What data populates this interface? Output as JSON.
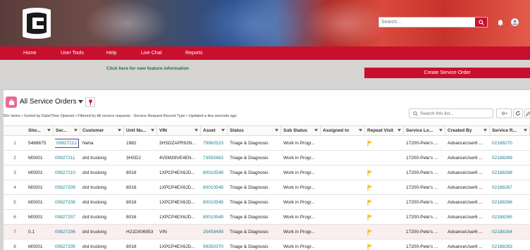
{
  "header": {
    "brand": "Cummins",
    "search_placeholder": "Search..."
  },
  "nav": {
    "items": [
      {
        "label": "Home"
      },
      {
        "label": "User Tools"
      },
      {
        "label": "Help"
      },
      {
        "label": "Live Chat"
      },
      {
        "label": "Reports"
      }
    ]
  },
  "feature_link": "Click here for new feature information",
  "create_button": "Create Service Order",
  "list": {
    "title": "All Service Orders",
    "meta": "50+ items • Sorted by Date/Time Opened • Filtered by All service requests - Service Request Record Type • Updated a few seconds ago",
    "search_placeholder": "Search this list..."
  },
  "columns": [
    "Sho...",
    "Ser...",
    "Customer",
    "Unit Nu...",
    "VIN",
    "Asset",
    "Status",
    "Sub Status",
    "Assigned to",
    "Repeat Visit",
    "Service Lo...",
    "Created By",
    "Service R..."
  ],
  "rows": [
    {
      "n": "1",
      "shop": "5468675",
      "sr": "00827212",
      "customer": "Neha",
      "unit": "1982",
      "vin": "3HSDZAPR9JN...",
      "asset": "79962523",
      "status": "Triage & Diagnosis",
      "sub": "Work in Progr...",
      "assigned": "",
      "repeat": true,
      "loc": "17200-Pete's ...",
      "created": "AdvanceUser6 ...",
      "svc": "02188270"
    },
    {
      "n": "2",
      "shop": "MS001",
      "sr": "00827211",
      "customer": "drd trucking",
      "unit": "3HSDJ",
      "vin": "4V5M39VE4EN...",
      "asset": "73592863",
      "status": "Triage & Diagnosis",
      "sub": "Work in Progr...",
      "assigned": "",
      "repeat": false,
      "loc": "17200-Pete's ...",
      "created": "AdvanceUser6 ...",
      "svc": "02188269"
    },
    {
      "n": "3",
      "shop": "MS001",
      "sr": "00827210",
      "customer": "drd trucking",
      "unit": "8016",
      "vin": "1XPCP4EX6JD...",
      "asset": "80010549",
      "status": "Triage & Diagnosis",
      "sub": "Work in Progr...",
      "assigned": "",
      "repeat": true,
      "loc": "17200-Pete's ...",
      "created": "AdvanceUser6 ...",
      "svc": "02188268"
    },
    {
      "n": "4",
      "shop": "MS001",
      "sr": "00827209",
      "customer": "drd trucking",
      "unit": "8016",
      "vin": "1XPCP4EX6JD...",
      "asset": "80010549",
      "status": "Triage & Diagnosis",
      "sub": "Work in Progr...",
      "assigned": "",
      "repeat": true,
      "loc": "17200-Pete's ...",
      "created": "AdvanceUser6 ...",
      "svc": "02188267"
    },
    {
      "n": "5",
      "shop": "MS001",
      "sr": "00827208",
      "customer": "drd trucking",
      "unit": "8016",
      "vin": "1XPCP4EX6JD...",
      "asset": "80010549",
      "status": "Triage & Diagnosis",
      "sub": "Work in Progr...",
      "assigned": "",
      "repeat": true,
      "loc": "17200-Pete's ...",
      "created": "AdvanceUser6 ...",
      "svc": "02188266"
    },
    {
      "n": "6",
      "shop": "MS001",
      "sr": "00827207",
      "customer": "drd trucking",
      "unit": "8016",
      "vin": "1XPCP4EX6JD...",
      "asset": "80010549",
      "status": "Triage & Diagnosis",
      "sub": "Work in Progr...",
      "assigned": "",
      "repeat": true,
      "loc": "17200-Pete's ...",
      "created": "AdvanceUser6 ...",
      "svc": "02188265"
    },
    {
      "n": "7",
      "shop": "0.1",
      "sr": "00827206",
      "customer": "drd trucking",
      "unit": "H21D006953",
      "vin": "VIN",
      "asset": "25459499",
      "status": "Triage & Diagnosis",
      "sub": "Work in Progr...",
      "assigned": "",
      "repeat": true,
      "loc": "17200-Pete's ...",
      "created": "AdvanceUser6 ...",
      "svc": "02188264"
    },
    {
      "n": "8",
      "shop": "MS001",
      "sr": "00827205",
      "customer": "drd trucking",
      "unit": "8016",
      "vin": "1XPCP4EX6JD...",
      "asset": "99350370",
      "status": "Triage & Diagnosis",
      "sub": "Work in Progr...",
      "assigned": "",
      "repeat": true,
      "loc": "17200-Pete's ...",
      "created": "AdvanceUser6 ...",
      "svc": "02188263"
    }
  ],
  "colors": {
    "brand_red": "#c8102e",
    "link": "#1a7f8e",
    "flag": "#f2c230",
    "list_icon": "#e66a96"
  }
}
